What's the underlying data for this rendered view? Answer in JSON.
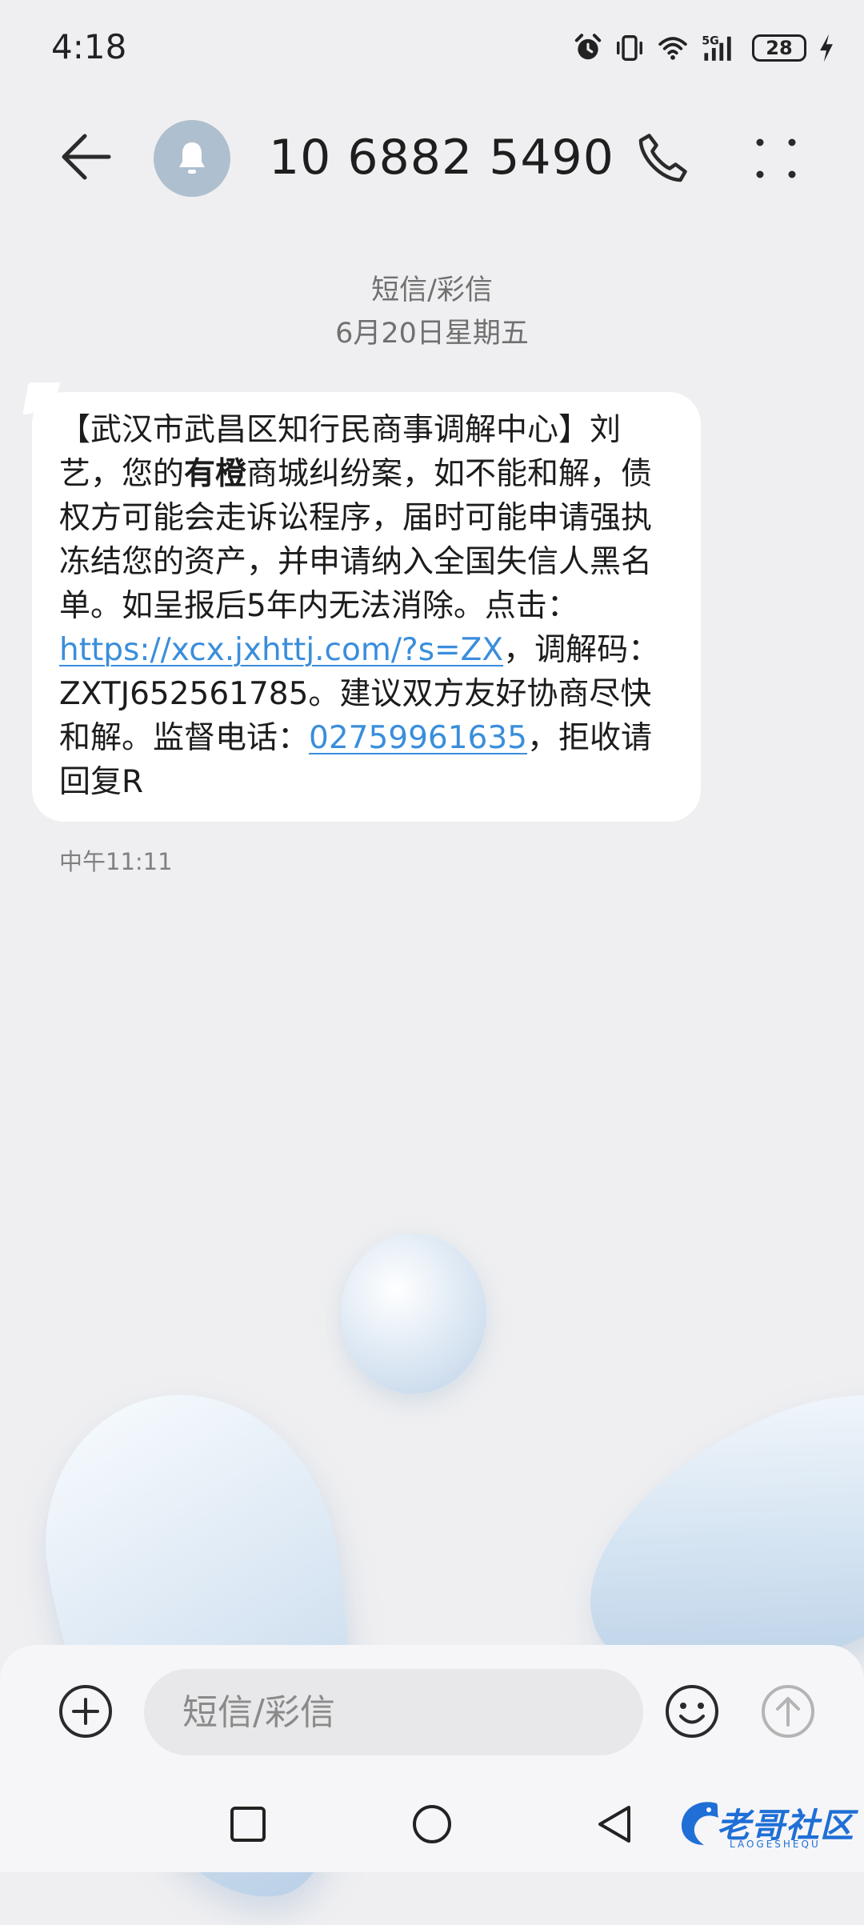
{
  "status_bar": {
    "time": "4:18",
    "battery": "28",
    "network": "5G",
    "icons": [
      "alarm-icon",
      "vibrate-icon",
      "wifi-icon",
      "signal-icon",
      "battery-icon",
      "charging-icon"
    ]
  },
  "header": {
    "title": "10 6882 5490",
    "avatar_icon": "bell-icon",
    "back_icon": "arrow-left-icon",
    "call_icon": "phone-icon",
    "more_icon": "more-dots-icon"
  },
  "conversation": {
    "channel": "短信/彩信",
    "date": "6月20日星期五",
    "message": {
      "seg1": "【武汉市武昌区知行民商事调解中心】刘艺，您的",
      "seg_bold": "有橙",
      "seg2": "商城纠纷案，如不能和解，债权方可能会走诉讼程序，届时可能申请强执冻结您的资产，并申请纳入全国失信人黑名单。如呈报后5年内无法消除。点击：",
      "link": "https://xcx.jxhttj.com/?s=ZX",
      "seg3": "，调解码：ZXTJ652561785。建议双方友好协商尽快和解。监督电话：",
      "phone": "02759961635",
      "seg4": "，拒收请回复R"
    },
    "time": "中午11:11"
  },
  "input_bar": {
    "placeholder": "短信/彩信",
    "add_icon": "plus-circle-icon",
    "emoji_icon": "smiley-icon",
    "send_icon": "send-arrow-icon"
  },
  "nav_bar": {
    "icons": [
      "square-recents-icon",
      "circle-home-icon",
      "triangle-back-icon"
    ]
  },
  "watermark": {
    "text": "老哥社区",
    "sub": "LAOGESHEQU"
  },
  "colors": {
    "background": "#efeff1",
    "bubble": "#ffffff",
    "link": "#3a8edb",
    "avatar": "#aebfcf"
  }
}
